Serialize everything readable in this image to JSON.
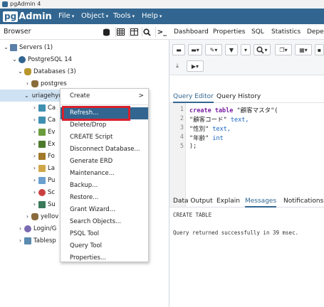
{
  "window": {
    "title": "pgAdmin 4"
  },
  "brand": {
    "logo_pg": "pg",
    "logo_rest": "Admin"
  },
  "menubar": {
    "file": "File",
    "object": "Object",
    "tools": "Tools",
    "help": "Help"
  },
  "browser": {
    "label": "Browser",
    "tree": {
      "servers": "Servers (1)",
      "postgres14": "PostgreSQL 14",
      "databases": "Databases (3)",
      "postgres": "postgres",
      "uriage": "uriagehyonaki",
      "ca1": "Ca",
      "ca2": "Ca",
      "ev": "Ev",
      "ex": "Ex",
      "fo": "Fo",
      "la": "La",
      "pu": "Pu",
      "sc": "Sc",
      "su": "Su",
      "yellow": "yellov",
      "login": "Login/G",
      "tablespaces": "Tablesp"
    }
  },
  "context_menu": {
    "items": [
      {
        "label": "Create",
        "has_submenu": true
      },
      {
        "label": "Refresh...",
        "highlighted": true
      },
      {
        "label": "Delete/Drop"
      },
      {
        "label": "CREATE Script"
      },
      {
        "label": "Disconnect Database..."
      },
      {
        "label": "Generate ERD"
      },
      {
        "label": "Maintenance..."
      },
      {
        "label": "Backup..."
      },
      {
        "label": "Restore..."
      },
      {
        "label": "Grant Wizard..."
      },
      {
        "label": "Search Objects..."
      },
      {
        "label": "PSQL Tool"
      },
      {
        "label": "Query Tool"
      },
      {
        "label": "Properties..."
      }
    ],
    "submenu_arrow": ">"
  },
  "right_tabs": {
    "dashboard": "Dashboard",
    "properties": "Properties",
    "sql": "SQL",
    "statistics": "Statistics",
    "dependencies": "Depe"
  },
  "query_tabs": {
    "editor": "Query Editor",
    "history": "Query History"
  },
  "editor": {
    "lines": [
      {
        "no": "1",
        "kw": "create table ",
        "rest": "\"顧客マスタ\"("
      },
      {
        "no": "2",
        "kw": "",
        "rest": "\"顧客コード\" ",
        "type": "text,"
      },
      {
        "no": "3",
        "kw": "",
        "rest": "\"性別\" ",
        "type": "text,"
      },
      {
        "no": "4",
        "kw": "",
        "rest": "\"年齢\" ",
        "type": "int"
      },
      {
        "no": "5",
        "kw": "",
        "rest": ");"
      }
    ]
  },
  "output_tabs": {
    "data": "Data Output",
    "explain": "Explain",
    "messages": "Messages",
    "notifications": "Notifications"
  },
  "output": {
    "line1": "CREATE TABLE",
    "line2": "Query returned successfully in 39 msec."
  },
  "colors": {
    "brand": "#326690",
    "highlight_box": "#d9202c",
    "selection": "#cfe2f3"
  },
  "icons": {
    "toolbar_browser": [
      "database-icon",
      "table-icon",
      "grid-icon",
      "search-icon",
      "terminal-icon"
    ],
    "query_toolbar": [
      "open-file-icon",
      "save-icon",
      "edit-icon",
      "filter-icon",
      "limit-icon",
      "execute-icon",
      "explain-icon",
      "commit-icon",
      "rollback-icon",
      "copy-icon",
      "download-icon",
      "macros-icon"
    ]
  }
}
